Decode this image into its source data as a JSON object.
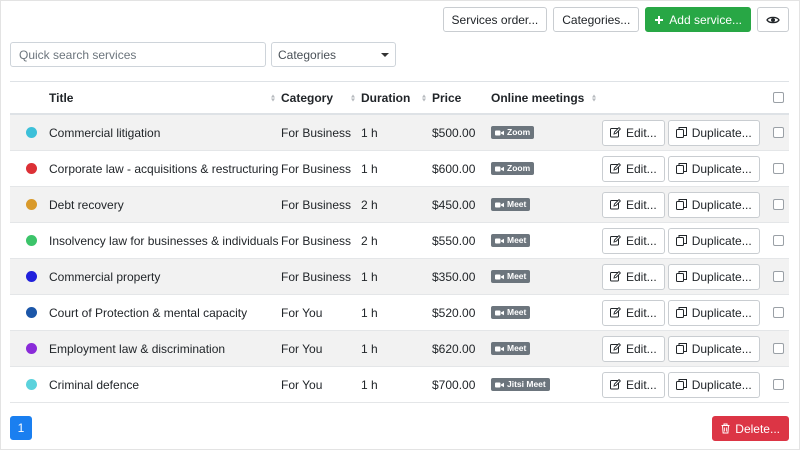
{
  "toolbar": {
    "services_order_label": "Services order...",
    "categories_label": "Categories...",
    "add_service_label": "Add service..."
  },
  "filters": {
    "search_placeholder": "Quick search services",
    "category_select_value": "Categories"
  },
  "table": {
    "headers": {
      "title": "Title",
      "category": "Category",
      "duration": "Duration",
      "price": "Price",
      "online": "Online meetings"
    },
    "edit_label": "Edit...",
    "duplicate_label": "Duplicate...",
    "rows": [
      {
        "color": "#3cc0d9",
        "title": "Commercial litigation",
        "category": "For Business",
        "duration": "1 h",
        "price": "$500.00",
        "online": "Zoom"
      },
      {
        "color": "#dc3036",
        "title": "Corporate law - acquisitions & restructuring",
        "category": "For Business",
        "duration": "1 h",
        "price": "$600.00",
        "online": "Zoom"
      },
      {
        "color": "#d99a2b",
        "title": "Debt recovery",
        "category": "For Business",
        "duration": "2 h",
        "price": "$450.00",
        "online": "Meet"
      },
      {
        "color": "#3cc46a",
        "title": "Insolvency law for businesses & individuals",
        "category": "For Business",
        "duration": "2 h",
        "price": "$550.00",
        "online": "Meet"
      },
      {
        "color": "#2020dc",
        "title": "Commercial property",
        "category": "For Business",
        "duration": "1 h",
        "price": "$350.00",
        "online": "Meet"
      },
      {
        "color": "#1b56a8",
        "title": "Court of Protection & mental capacity",
        "category": "For You",
        "duration": "1 h",
        "price": "$520.00",
        "online": "Meet"
      },
      {
        "color": "#8a2bd9",
        "title": "Employment law & discrimination",
        "category": "For You",
        "duration": "1 h",
        "price": "$620.00",
        "online": "Meet"
      },
      {
        "color": "#5bd2dc",
        "title": "Criminal defence",
        "category": "For You",
        "duration": "1 h",
        "price": "$700.00",
        "online": "Jitsi Meet"
      }
    ]
  },
  "pagination": {
    "current_page": "1"
  },
  "footer": {
    "delete_label": "Delete..."
  },
  "colors": {
    "success": "#28a745",
    "danger": "#dc3545",
    "primary": "#1a7ff0",
    "badge": "#6c757d"
  },
  "icons": [
    "plus-icon",
    "eye-icon",
    "edit-icon",
    "duplicate-icon",
    "video-icon",
    "trash-icon",
    "sort-icon",
    "chevron-down-icon"
  ]
}
